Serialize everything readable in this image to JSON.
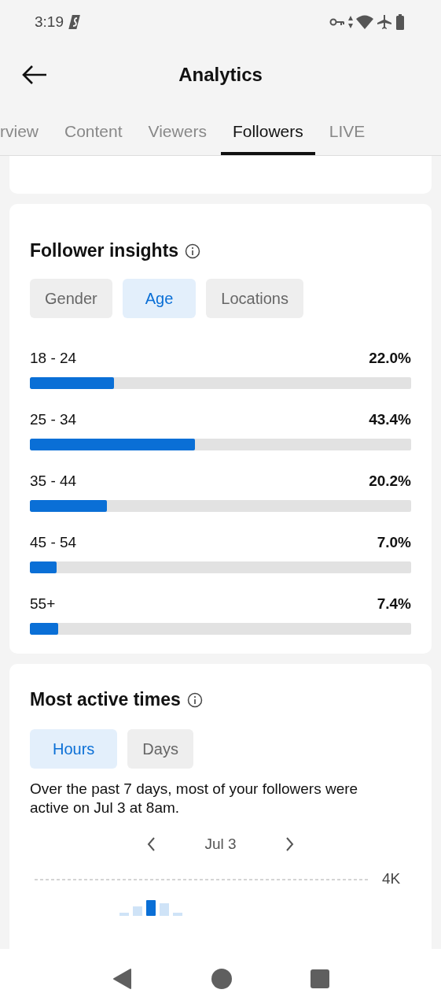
{
  "status_bar": {
    "time": "3:19"
  },
  "header": {
    "title": "Analytics"
  },
  "tabs": [
    {
      "label": "rview",
      "selected": false
    },
    {
      "label": "Content",
      "selected": false
    },
    {
      "label": "Viewers",
      "selected": false
    },
    {
      "label": "Followers",
      "selected": true
    },
    {
      "label": "LIVE",
      "selected": false
    }
  ],
  "follower_insights": {
    "title": "Follower insights",
    "filters": [
      {
        "label": "Gender",
        "selected": false
      },
      {
        "label": "Age",
        "selected": true
      },
      {
        "label": "Locations",
        "selected": false
      }
    ],
    "rows": [
      {
        "label": "18 - 24",
        "value": "22.0%",
        "level": 0.22
      },
      {
        "label": "25 - 34",
        "value": "43.4%",
        "level": 0.434
      },
      {
        "label": "35 - 44",
        "value": "20.2%",
        "level": 0.202
      },
      {
        "label": "45 - 54",
        "value": "7.0%",
        "level": 0.07
      },
      {
        "label": "55+",
        "value": "7.4%",
        "level": 0.074
      }
    ]
  },
  "most_active_times": {
    "title": "Most active times",
    "filters": [
      {
        "label": "Hours",
        "selected": true
      },
      {
        "label": "Days",
        "selected": false
      }
    ],
    "summary": "Over the past 7 days, most of your followers were active on Jul 3 at 8am.",
    "date": "Jul 3",
    "axis_label": "4K"
  }
}
